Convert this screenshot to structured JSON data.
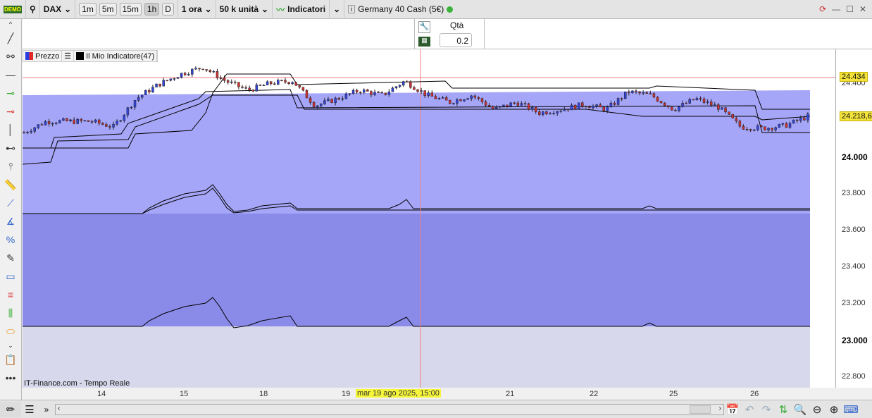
{
  "toolbar": {
    "demo": "DEMO",
    "symbol": "DAX",
    "timeframes": [
      "1m",
      "5m",
      "15m",
      "1h",
      "D"
    ],
    "selected_timeframe": "1h",
    "period": "1 ora",
    "units": "50 k unità",
    "indicators": "Indicatori",
    "instrument": "Germany 40 Cash (5€)",
    "status_color": "#3bb33b"
  },
  "order_panel": {
    "qty_label": "Qtà",
    "qty_value": "0.2"
  },
  "legend": {
    "price": "Prezzo",
    "indicator": "Il Mio Indicatore(47)"
  },
  "price_axis": {
    "labels": [
      "24.400",
      "24.000",
      "23.800",
      "23.600",
      "23.400",
      "23.200",
      "23.000",
      "22.800"
    ],
    "current_price": "24.218,6",
    "line_price": "24.434"
  },
  "time_axis": {
    "labels": [
      "14",
      "15",
      "18",
      "19",
      "21",
      "22",
      "25",
      "26"
    ],
    "cursor_label": "mar 19 ago 2025, 15:00"
  },
  "source": "IT-Finance.com - Tempo Reale",
  "chart_data": {
    "type": "candlestick",
    "closes_anchor": [
      24134,
      24195,
      24195,
      24195,
      24165,
      24318,
      24395,
      24452,
      24490,
      24414,
      24364,
      24402,
      24414,
      24280,
      24318,
      24364,
      24337,
      24414,
      24337,
      24299,
      24337,
      24260,
      24299,
      24241,
      24260,
      24287,
      24260,
      24356,
      24337,
      24260,
      24318,
      24272,
      24165,
      24157,
      24172,
      24222
    ],
    "ylim": [
      22750,
      24600
    ]
  }
}
